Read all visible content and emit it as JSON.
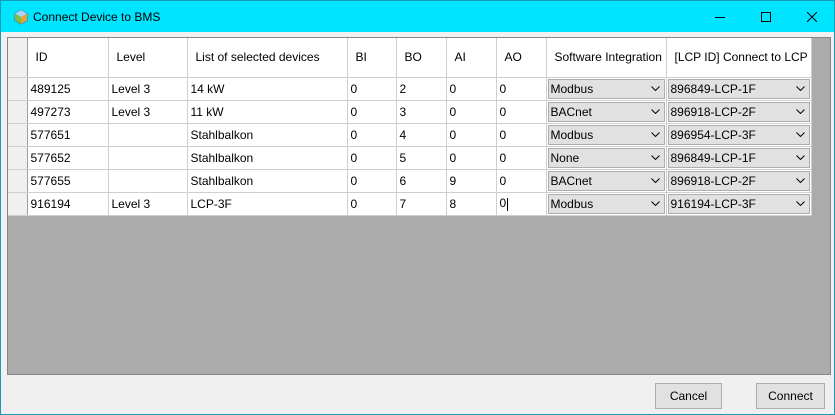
{
  "window": {
    "title": "Connect Device to BMS",
    "icon": "app-logo-icon"
  },
  "columns": [
    "ID",
    "Level",
    "List of selected devices",
    "BI",
    "BO",
    "AI",
    "AO",
    "Software Integration",
    "[LCP ID] Connect to LCP"
  ],
  "rows": [
    {
      "id": "489125",
      "level": "Level 3",
      "device": "14 kW",
      "bi": "0",
      "bo": "2",
      "ai": "0",
      "ao": "0",
      "integration": "Modbus",
      "lcp": "896849-LCP-1F"
    },
    {
      "id": "497273",
      "level": "Level 3",
      "device": "11 kW",
      "bi": "0",
      "bo": "3",
      "ai": "0",
      "ao": "0",
      "integration": "BACnet",
      "lcp": "896918-LCP-2F"
    },
    {
      "id": "577651",
      "level": "",
      "device": "Stahlbalkon",
      "bi": "0",
      "bo": "4",
      "ai": "0",
      "ao": "0",
      "integration": "Modbus",
      "lcp": "896954-LCP-3F"
    },
    {
      "id": "577652",
      "level": "",
      "device": "Stahlbalkon",
      "bi": "0",
      "bo": "5",
      "ai": "0",
      "ao": "0",
      "integration": "None",
      "lcp": "896849-LCP-1F"
    },
    {
      "id": "577655",
      "level": "",
      "device": "Stahlbalkon",
      "bi": "0",
      "bo": "6",
      "ai": "9",
      "ao": "0",
      "integration": "BACnet",
      "lcp": "896918-LCP-2F"
    },
    {
      "id": "916194",
      "level": "Level 3",
      "device": "LCP-3F",
      "bi": "0",
      "bo": "7",
      "ai": "8",
      "ao": "0",
      "integration": "Modbus",
      "lcp": "916194-LCP-3F"
    }
  ],
  "buttons": {
    "cancel": "Cancel",
    "connect": "Connect"
  },
  "colors": {
    "titlebar": "#00e5ff",
    "grid_empty": "#ababab",
    "button_face": "#e1e1e1"
  }
}
